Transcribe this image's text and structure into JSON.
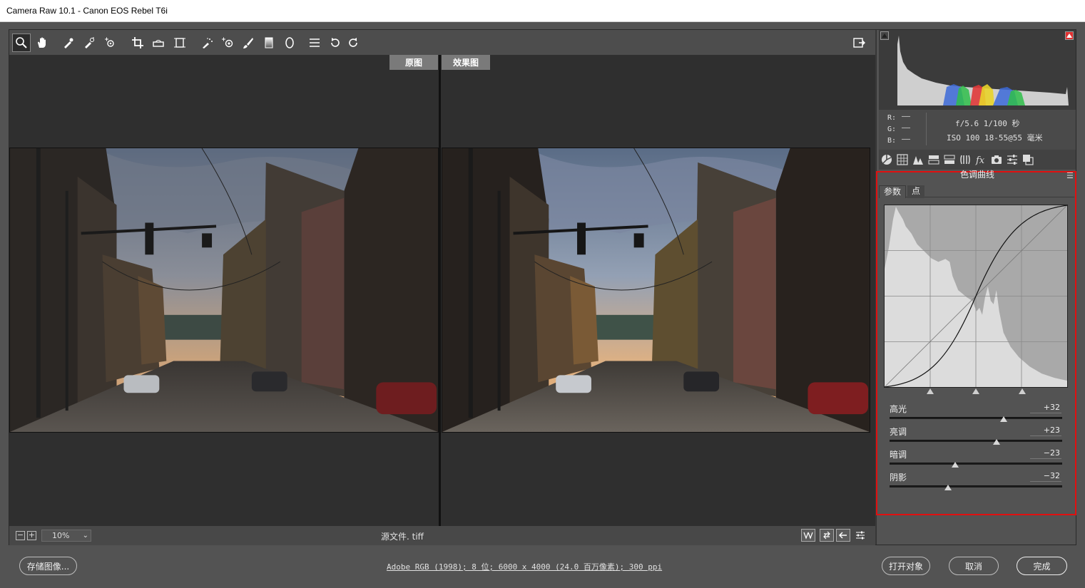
{
  "window": {
    "title": "Camera Raw 10.1 -  Canon EOS Rebel T6i"
  },
  "toolbar": {
    "tools": [
      {
        "name": "zoom-tool-icon",
        "active": true
      },
      {
        "name": "hand-tool-icon"
      },
      {
        "name": "white-balance-tool-icon"
      },
      {
        "name": "color-sampler-tool-icon"
      },
      {
        "name": "targeted-adjustment-tool-icon"
      },
      {
        "name": "crop-tool-icon"
      },
      {
        "name": "straighten-tool-icon"
      },
      {
        "name": "transform-tool-icon"
      },
      {
        "name": "spot-removal-tool-icon"
      },
      {
        "name": "red-eye-tool-icon"
      },
      {
        "name": "adjustment-brush-icon"
      },
      {
        "name": "graduated-filter-icon"
      },
      {
        "name": "radial-filter-icon"
      },
      {
        "name": "preferences-list-icon"
      },
      {
        "name": "rotate-left-icon"
      },
      {
        "name": "rotate-right-icon"
      }
    ],
    "fullscreen_icon": "fullscreen-toggle-icon"
  },
  "preview": {
    "before_label": "原图",
    "after_label": "效果图"
  },
  "status": {
    "zoom_minus": "−",
    "zoom_plus": "+",
    "zoom_value": "10%",
    "filename": "源文件. tiff"
  },
  "histogram": {
    "shadow_clip": "shadow-clipping-warning-icon",
    "highlight_clip": "highlight-clipping-warning-icon"
  },
  "info": {
    "r_label": "R:",
    "g_label": "G:",
    "b_label": "B:",
    "r_value": "——",
    "g_value": "——",
    "b_value": "——",
    "aperture_shutter": "f/5.6   1/100 秒",
    "iso_lens": "ISO 100   18-55@55 毫米"
  },
  "panel": {
    "title": "色调曲线",
    "tabs": [
      {
        "label": "参数",
        "active": true
      },
      {
        "label": "点",
        "active": false
      }
    ]
  },
  "curve": {
    "split_points": [
      0.25,
      0.5,
      0.75
    ]
  },
  "sliders": [
    {
      "label": "高光",
      "value": "+32",
      "position": 0.66
    },
    {
      "label": "亮调",
      "value": "+23",
      "position": 0.62
    },
    {
      "label": "暗调",
      "value": "−23",
      "position": 0.38
    },
    {
      "label": "阴影",
      "value": "−32",
      "position": 0.34
    }
  ],
  "footer": {
    "save_label": "存储图像...",
    "workflow_link": "Adobe RGB (1998); 8 位; 6000 x 4000 (24.0 百万像素); 300 ppi",
    "open_object_label": "打开对象",
    "cancel_label": "取消",
    "done_label": "完成"
  },
  "colors": {
    "highlight_border": "#e01010",
    "panel_bg": "#535353"
  }
}
